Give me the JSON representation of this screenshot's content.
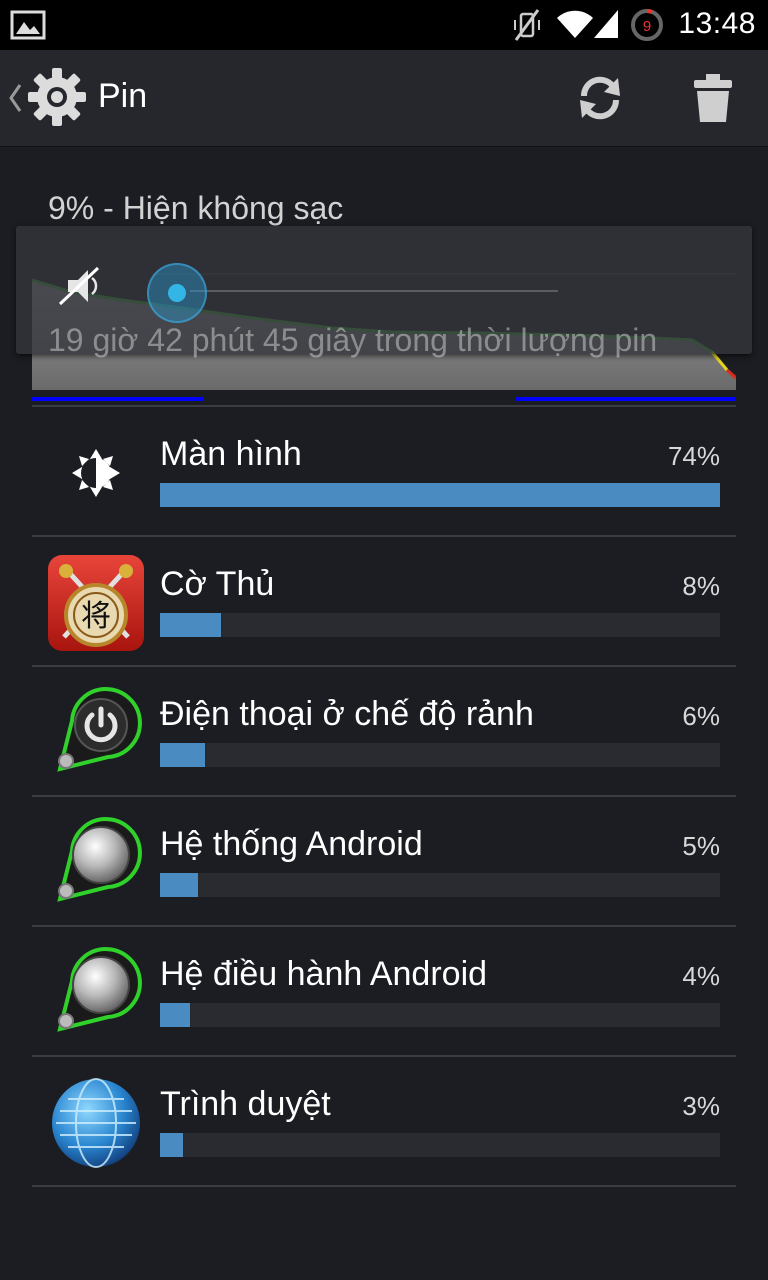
{
  "status_bar": {
    "time": "13:48",
    "notification_count": "9",
    "icons": [
      "gallery-icon",
      "vibrate-muted-icon",
      "wifi-icon",
      "signal-icon",
      "notification-count-icon"
    ]
  },
  "action_bar": {
    "title": "Pin",
    "icons": [
      "back-chevron-icon",
      "settings-gear-icon",
      "refresh-icon",
      "trash-icon"
    ]
  },
  "battery": {
    "status": "9% - Hiện không sạc",
    "duration": "19 giờ 42 phút 45 giây trong thời lượng pin"
  },
  "volume_overlay": {
    "icon": "speaker-muted-icon",
    "level": 0
  },
  "usage": [
    {
      "name": "Màn hình",
      "percent_label": "74%",
      "percent": 74,
      "icon": "screen-brightness-icon"
    },
    {
      "name": "Cờ Thủ",
      "percent_label": "8%",
      "percent": 8,
      "icon": "chinese-chess-app-icon"
    },
    {
      "name": "Điện thoại ở chế độ rảnh",
      "percent_label": "6%",
      "percent": 6,
      "icon": "power-button-icon"
    },
    {
      "name": "Hệ thống Android",
      "percent_label": "5%",
      "percent": 5,
      "icon": "android-system-icon"
    },
    {
      "name": "Hệ điều hành Android",
      "percent_label": "4%",
      "percent": 4,
      "icon": "android-os-icon"
    },
    {
      "name": "Trình duyệt",
      "percent_label": "3%",
      "percent": 3,
      "icon": "browser-globe-icon"
    }
  ],
  "colors": {
    "bar_fill": "#4a8cc2",
    "graph_line": "#3aa832",
    "charging_indicator": "#0000ff",
    "accent": "#33b5e5"
  }
}
